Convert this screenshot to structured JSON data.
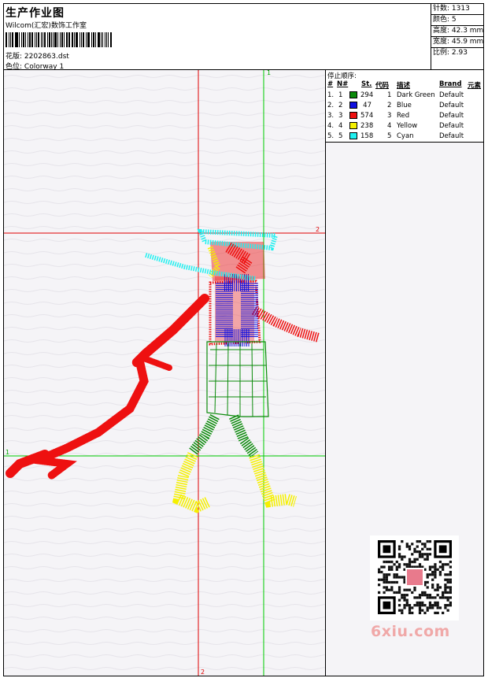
{
  "header": {
    "title": "生产作业图",
    "company": "Wilcom(汇宏)数饰工作室",
    "file_label": "花版:",
    "file_value": "2202863.dst",
    "color_label": "色位:",
    "color_value": "Colorway 1"
  },
  "stats": {
    "stitches": "针数: 1313",
    "colors": "颜色: 5",
    "height": "高度: 42.3 mm",
    "width": "宽度: 45.9 mm",
    "scale": "比例: 2.93"
  },
  "guides": {
    "v1": "1",
    "h2": "2",
    "h1": "1",
    "v2": "2"
  },
  "stop_sequence": {
    "title": "停止顺序:",
    "headers": [
      "#",
      "N#",
      "St.",
      "代码",
      "描述",
      "Brand",
      "元素"
    ],
    "rows": [
      {
        "idx": "1.",
        "n": "1",
        "color": "#0a8a0a",
        "st": "294",
        "code": "1",
        "desc": "Dark Green",
        "brand": "Default"
      },
      {
        "idx": "2.",
        "n": "2",
        "color": "#1010e0",
        "st": "47",
        "code": "2",
        "desc": "Blue",
        "brand": "Default"
      },
      {
        "idx": "3.",
        "n": "3",
        "color": "#ee1010",
        "st": "574",
        "code": "3",
        "desc": "Red",
        "brand": "Default"
      },
      {
        "idx": "4.",
        "n": "4",
        "color": "#f5f000",
        "st": "238",
        "code": "4",
        "desc": "Yellow",
        "brand": "Default"
      },
      {
        "idx": "5.",
        "n": "5",
        "color": "#20f0f0",
        "st": "158",
        "code": "5",
        "desc": "Cyan",
        "brand": "Default"
      }
    ]
  },
  "watermark": "6xiu.com",
  "palette": {
    "red_guide": "#e00000",
    "green_guide": "#00cc00",
    "background": "#f5f4f7"
  }
}
